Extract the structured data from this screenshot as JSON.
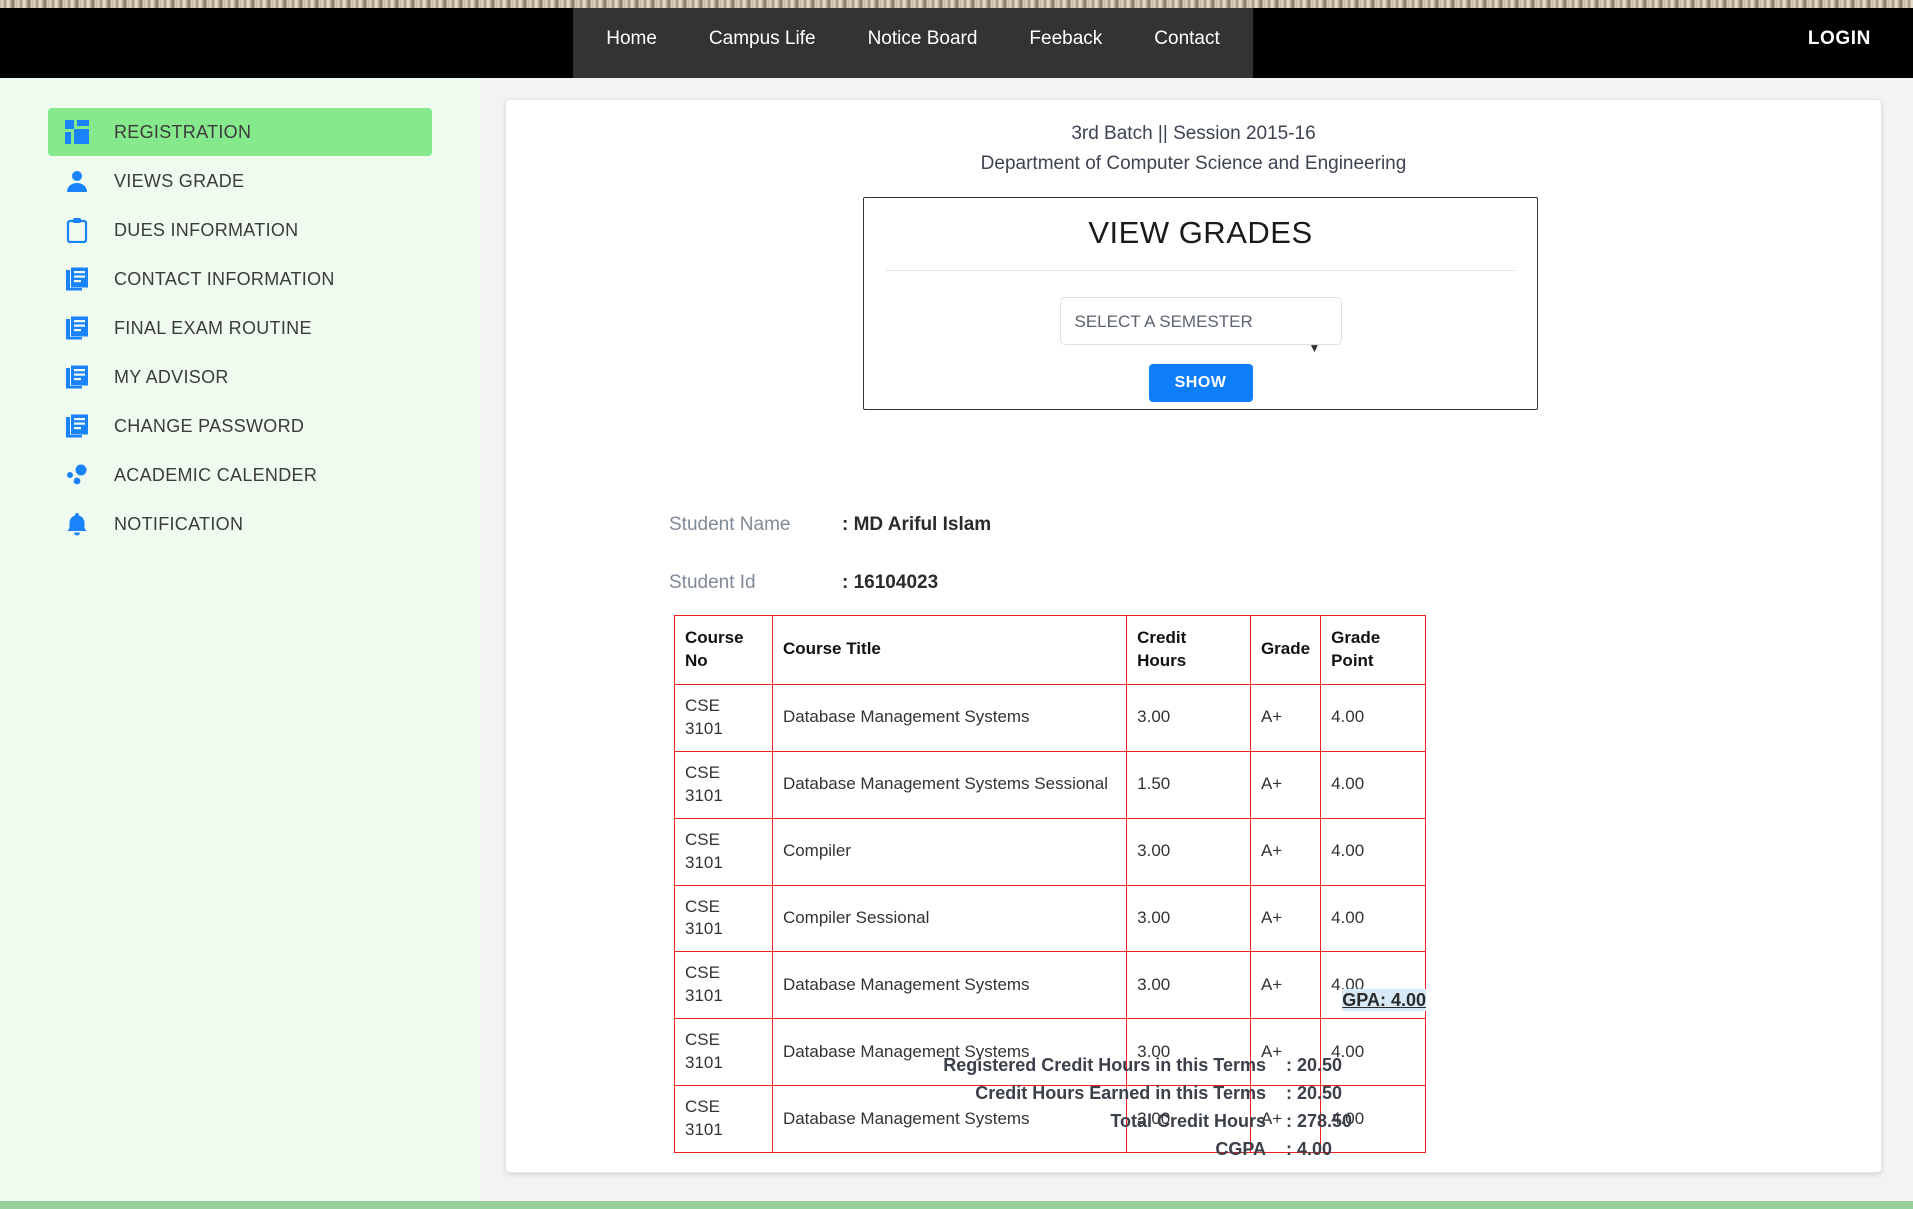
{
  "navbar": {
    "links": [
      {
        "label": "Home",
        "name": "nav-home"
      },
      {
        "label": "Campus Life",
        "name": "nav-campus-life"
      },
      {
        "label": "Notice Board",
        "name": "nav-notice-board"
      },
      {
        "label": "Feeback",
        "name": "nav-feedback"
      },
      {
        "label": "Contact",
        "name": "nav-contact"
      }
    ],
    "login_label": "LOGIN",
    "bar_color": "#000000",
    "center_color": "#333333"
  },
  "sidebar": {
    "active_color": "#86e98c",
    "background_color": "#eefbee",
    "icon_color": "#1a82fb",
    "items": [
      {
        "label": "REGISTRATION",
        "icon": "dashboard-grid-icon",
        "active": true
      },
      {
        "label": "VIEWS GRADE",
        "icon": "user-person-icon",
        "active": false
      },
      {
        "label": "DUES INFORMATION",
        "icon": "clipboard-icon",
        "active": false
      },
      {
        "label": "CONTACT INFORMATION",
        "icon": "documents-icon",
        "active": false
      },
      {
        "label": "FINAL EXAM ROUTINE",
        "icon": "documents-icon",
        "active": false
      },
      {
        "label": "MY ADVISOR",
        "icon": "documents-icon",
        "active": false
      },
      {
        "label": "CHANGE PASSWORD",
        "icon": "documents-icon",
        "active": false
      },
      {
        "label": "ACADEMIC CALENDER",
        "icon": "dots-bubbles-icon",
        "active": false
      },
      {
        "label": "NOTIFICATION",
        "icon": "bell-icon",
        "active": false
      }
    ]
  },
  "grades_panel": {
    "title": "VIEW GRADES",
    "semester_selected": "SELECT A SEMESTER",
    "semester_options": [
      "SELECT A SEMESTER"
    ],
    "show_label": "SHOW",
    "caret": "▼",
    "button_color": "#0d7ef7"
  },
  "student": {
    "batch_line": "3rd Batch || Session 2015-16",
    "department_line": "Department of Computer Science and Engineering",
    "name_label": "Student Name",
    "name_value": ": MD Ariful Islam",
    "id_label": "Student Id",
    "id_value": ": 16104023"
  },
  "grades_table": {
    "border_color": "#ee2222",
    "headers": [
      "Course No",
      "Course Title",
      "Credit Hours",
      "Grade",
      "Grade Point"
    ],
    "headers_split": [
      [
        "Course",
        "No"
      ],
      [
        "Course Title"
      ],
      [
        "Credit",
        "Hours"
      ],
      [
        "Grade"
      ],
      [
        "Grade",
        "Point"
      ]
    ],
    "rows": [
      {
        "course_no": "CSE 3101",
        "title": "Database Management Systems",
        "credit_hours": "3.00",
        "grade": "A+",
        "grade_point": "4.00"
      },
      {
        "course_no": "CSE 3101",
        "title": "Database Management Systems Sessional",
        "credit_hours": "1.50",
        "grade": "A+",
        "grade_point": "4.00"
      },
      {
        "course_no": "CSE 3101",
        "title": "Compiler",
        "credit_hours": "3.00",
        "grade": "A+",
        "grade_point": "4.00"
      },
      {
        "course_no": "CSE 3101",
        "title": "Compiler Sessional",
        "credit_hours": "3.00",
        "grade": "A+",
        "grade_point": "4.00"
      },
      {
        "course_no": "CSE 3101",
        "title": "Database Management Systems",
        "credit_hours": "3.00",
        "grade": "A+",
        "grade_point": "4.00"
      },
      {
        "course_no": "CSE 3101",
        "title": "Database Management Systems",
        "credit_hours": "3.00",
        "grade": "A+",
        "grade_point": "4.00"
      },
      {
        "course_no": "CSE 3101",
        "title": "Database Management Systems",
        "credit_hours": "3.00",
        "grade": "A+",
        "grade_point": "4.00"
      }
    ],
    "gpa_text": "GPA: 4.00"
  },
  "summary": {
    "rows": [
      {
        "label": "Registered Credit Hours in this Terms",
        "value": ": 20.50"
      },
      {
        "label": "Credit Hours Earned in this Terms",
        "value": ": 20.50"
      },
      {
        "label": "Total Credit Hours",
        "value": ": 278.50"
      },
      {
        "label": "CGPA",
        "value": ": 4.00"
      }
    ]
  }
}
